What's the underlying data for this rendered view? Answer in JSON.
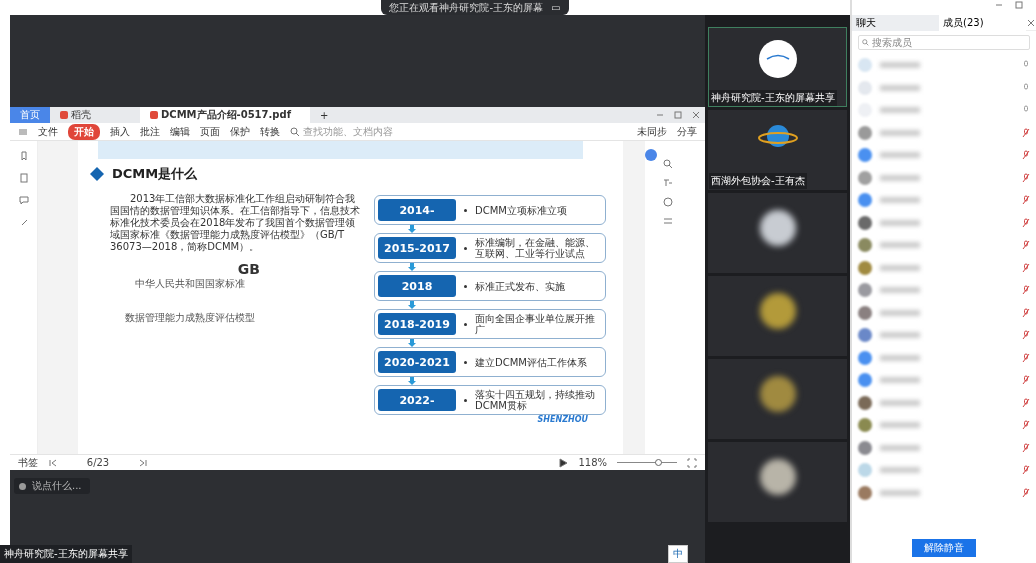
{
  "share_banner": {
    "text": "您正在观看神舟研究院-王东的屏幕",
    "icon": "▭"
  },
  "pdf_window": {
    "tabs": [
      {
        "label": "首页",
        "kind": "home",
        "selected": false
      },
      {
        "label": "稻壳",
        "kind": "app",
        "selected": false
      },
      {
        "label": "DCMM产品介绍-0517.pdf",
        "kind": "doc",
        "selected": true
      }
    ],
    "new_tab": "+",
    "menu": [
      {
        "label": "文件",
        "selected": false
      },
      {
        "label": "开始",
        "selected": true
      },
      {
        "label": "插入",
        "selected": false
      },
      {
        "label": "批注",
        "selected": false
      },
      {
        "label": "编辑",
        "selected": false
      },
      {
        "label": "页面",
        "selected": false
      },
      {
        "label": "保护",
        "selected": false
      },
      {
        "label": "转换",
        "selected": false
      }
    ],
    "search_placeholder": "查找功能、文档内容",
    "sync": "未同步",
    "share": "分享",
    "slide": {
      "heading": "DCMM是什么",
      "paragraph": "2013年工信部大数据标准化工作组启动研制符合我国国情的数据管理知识体系。在工信部指导下，信息技术标准化技术委员会在2018年发布了我国首个数据管理领域国家标准《数据管理能力成熟度评估模型》（GB/T 36073—2018，简称DCMM）。",
      "standard_doc": {
        "mark": "GB",
        "issuer": "中华人民共和国国家标准",
        "title": "数据管理能力成熟度评估模型"
      },
      "timeline": [
        {
          "year": "2014-",
          "text": "DCMM立项标准立项"
        },
        {
          "year": "2015-2017",
          "text": "标准编制，在金融、能源、互联网、工业等行业试点"
        },
        {
          "year": "2018",
          "text": "标准正式发布、实施"
        },
        {
          "year": "2018-2019",
          "text": "面向全国企事业单位展开推广"
        },
        {
          "year": "2020-2021",
          "text": "建立DCMM评估工作体系"
        },
        {
          "year": "2022-",
          "text": "落实十四五规划，持续推动DCMM贯标"
        }
      ],
      "logo_text": "SHENZHOU"
    },
    "bottom_bar": {
      "bookmarks": "书签",
      "page": "6/23",
      "zoom": "118%",
      "level": 0.7
    }
  },
  "chat_input": {
    "placeholder": "说点什么..."
  },
  "share_label": "神舟研究院-王东的屏幕共享",
  "ime": "中",
  "video_tiles": [
    {
      "kind": "logo",
      "name": "神舟研究院-王东的屏幕共享",
      "active": true
    },
    {
      "kind": "globe",
      "name": "西湖外包协会-王有杰",
      "active": false
    },
    {
      "kind": "blurred",
      "color": "#c8ccd2",
      "active": false
    },
    {
      "kind": "blurred",
      "color": "#b39a3a",
      "active": false
    },
    {
      "kind": "blurred",
      "color": "#a08a40",
      "active": false
    },
    {
      "kind": "blurred",
      "color": "#b8b4a8",
      "active": false
    }
  ],
  "sidebar": {
    "tabs": [
      {
        "label": "聊天",
        "selected": false
      },
      {
        "label": "成员(23)",
        "selected": true
      }
    ],
    "search_placeholder": "搜索成员",
    "members": [
      {
        "color": "#d8e6f2",
        "muted": false
      },
      {
        "color": "#e4e8ee",
        "muted": false
      },
      {
        "color": "#eef0f4",
        "muted": false
      },
      {
        "color": "#9a9a9a",
        "muted": true
      },
      {
        "color": "#4a90f0",
        "muted": true
      },
      {
        "color": "#a0a0a0",
        "muted": true
      },
      {
        "color": "#4a90f0",
        "muted": true
      },
      {
        "color": "#6a6a6a",
        "muted": true
      },
      {
        "color": "#8a8a60",
        "muted": true
      },
      {
        "color": "#a08a40",
        "muted": true
      },
      {
        "color": "#9a9aa0",
        "muted": true
      },
      {
        "color": "#8a8080",
        "muted": true
      },
      {
        "color": "#6a88c8",
        "muted": true
      },
      {
        "color": "#4a90f0",
        "muted": true
      },
      {
        "color": "#4a90f0",
        "muted": true
      },
      {
        "color": "#7a6a58",
        "muted": true
      },
      {
        "color": "#8a8a50",
        "muted": true
      },
      {
        "color": "#8a8a90",
        "muted": true
      },
      {
        "color": "#bcd8e8",
        "muted": true
      },
      {
        "color": "#9a7a60",
        "muted": true
      }
    ],
    "unmute_button": "解除静音"
  }
}
